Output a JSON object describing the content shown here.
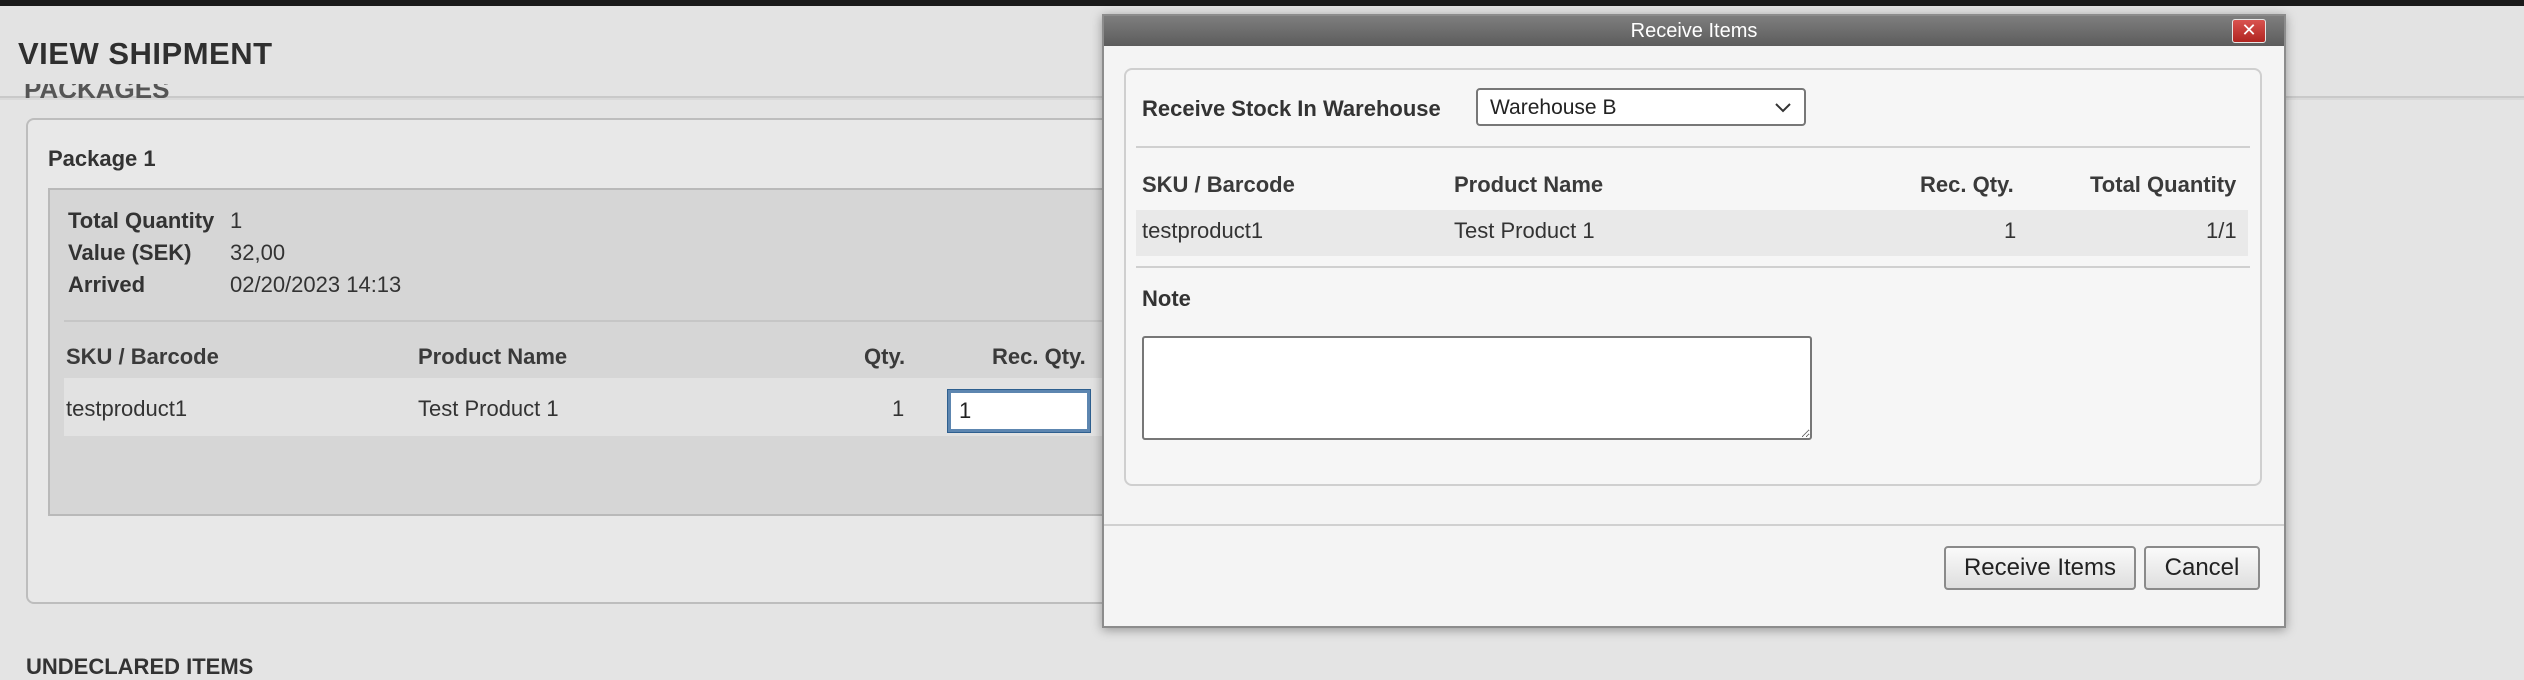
{
  "page": {
    "title": "VIEW SHIPMENT",
    "section_title": "PACKAGES",
    "undeclared_title": "UNDECLARED ITEMS"
  },
  "package": {
    "title": "Package 1",
    "info": [
      {
        "label": "Total Quantity",
        "value": "1"
      },
      {
        "label": "Value (SEK)",
        "value": "32,00"
      },
      {
        "label": "Arrived",
        "value": "02/20/2023 14:13"
      }
    ],
    "columns": {
      "sku": "SKU / Barcode",
      "name": "Product Name",
      "qty": "Qty.",
      "rec_qty": "Rec. Qty."
    },
    "row": {
      "sku": "testproduct1",
      "name": "Test Product 1",
      "qty": "1",
      "rec_qty_value": "1"
    }
  },
  "modal": {
    "title": "Receive Items",
    "close_icon": "close-icon",
    "warehouse_label": "Receive Stock In Warehouse",
    "warehouse_selected": "Warehouse B",
    "columns": {
      "sku": "SKU / Barcode",
      "name": "Product Name",
      "rec_qty": "Rec. Qty.",
      "total_qty": "Total Quantity"
    },
    "row": {
      "sku": "testproduct1",
      "name": "Test Product 1",
      "rec_qty": "1",
      "total_qty": "1/1"
    },
    "note_label": "Note",
    "note_value": "",
    "receive_button": "Receive Items",
    "cancel_button": "Cancel"
  },
  "colors": {
    "titlebar": "#6b6b6b",
    "close_button": "#c9302c",
    "focus_border": "#5d86b0"
  }
}
